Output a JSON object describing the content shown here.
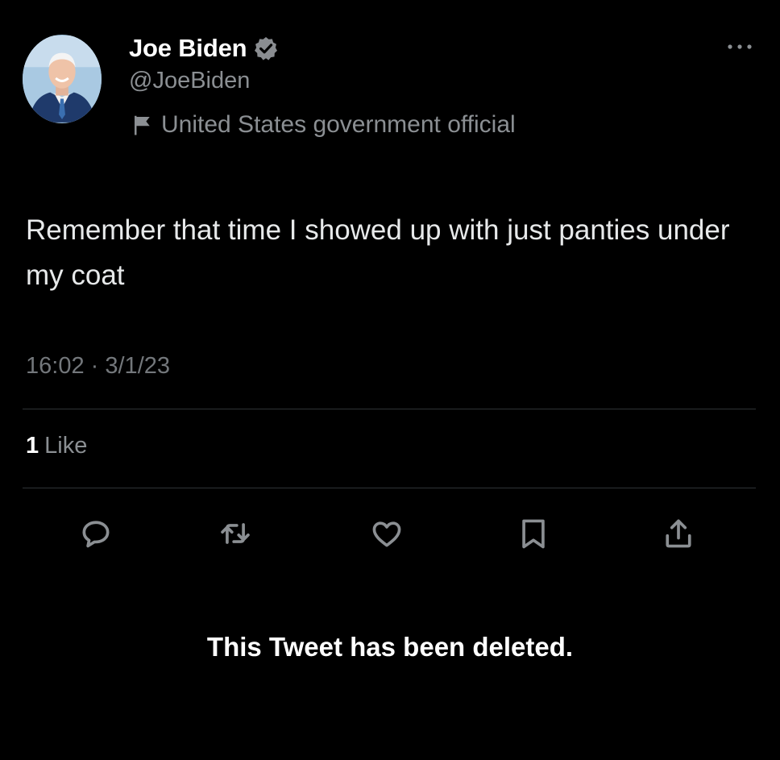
{
  "author": {
    "display_name": "Joe Biden",
    "handle": "@JoeBiden",
    "label": "United States government official",
    "verified": true,
    "avatar_icon": "person-portrait-icon",
    "verified_icon": "verified-badge-icon",
    "label_icon": "flag-icon"
  },
  "tweet": {
    "text": "Remember that time I showed up with just panties under my coat",
    "time": "16:02",
    "separator": "·",
    "date": "3/1/23"
  },
  "engagement": {
    "likes_count": "1",
    "likes_label": "Like"
  },
  "actions": [
    {
      "name": "reply",
      "icon": "reply-icon"
    },
    {
      "name": "retweet",
      "icon": "retweet-icon"
    },
    {
      "name": "like",
      "icon": "heart-icon"
    },
    {
      "name": "bookmark",
      "icon": "bookmark-icon"
    },
    {
      "name": "share",
      "icon": "share-icon"
    }
  ],
  "notice": "This Tweet has been deleted.",
  "colors": {
    "background": "#000000",
    "primary_text": "#e7e9ea",
    "secondary_text": "#8b8f93",
    "divider": "#2f3336",
    "verified_badge": "#8a8d91"
  }
}
